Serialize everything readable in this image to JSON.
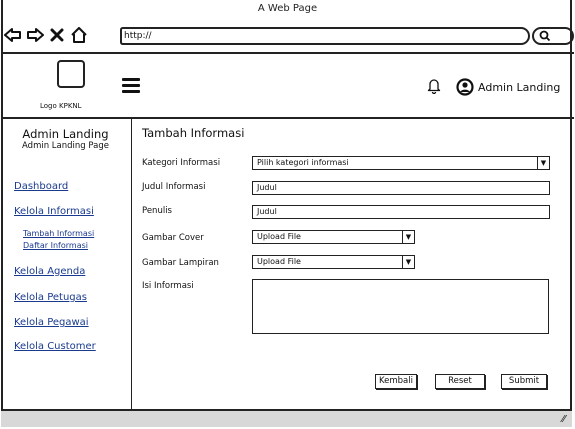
{
  "browser": {
    "title": "A Web Page",
    "url": "http://"
  },
  "header": {
    "logo_label": "Logo KPKNL",
    "user_name": "Admin Landing"
  },
  "sidebar": {
    "title": "Admin Landing",
    "subtitle": "Admin Landing Page",
    "items": [
      {
        "label": "Dashboard"
      },
      {
        "label": "Kelola Informasi"
      },
      {
        "label": "Tambah Informasi"
      },
      {
        "label": "Daftar Informasi"
      },
      {
        "label": "Kelola Agenda"
      },
      {
        "label": "Kelola Petugas"
      },
      {
        "label": "Kelola Pegawai"
      },
      {
        "label": "Kelola Customer"
      }
    ]
  },
  "form": {
    "heading": "Tambah Informasi",
    "kategori_label": "Kategori Informasi",
    "kategori_value": "Pilih kategori informasi",
    "judul_label": "Judul Informasi",
    "judul_value": "Judul",
    "penulis_label": "Penulis",
    "penulis_value": "Judul",
    "cover_label": "Gambar Cover",
    "cover_value": "Upload File",
    "lampiran_label": "Gambar Lampiran",
    "lampiran_value": "Upload File",
    "isi_label": "Isi Informasi",
    "isi_value": ""
  },
  "buttons": {
    "kembali": "Kembali",
    "reset": "Reset",
    "submit": "Submit"
  }
}
